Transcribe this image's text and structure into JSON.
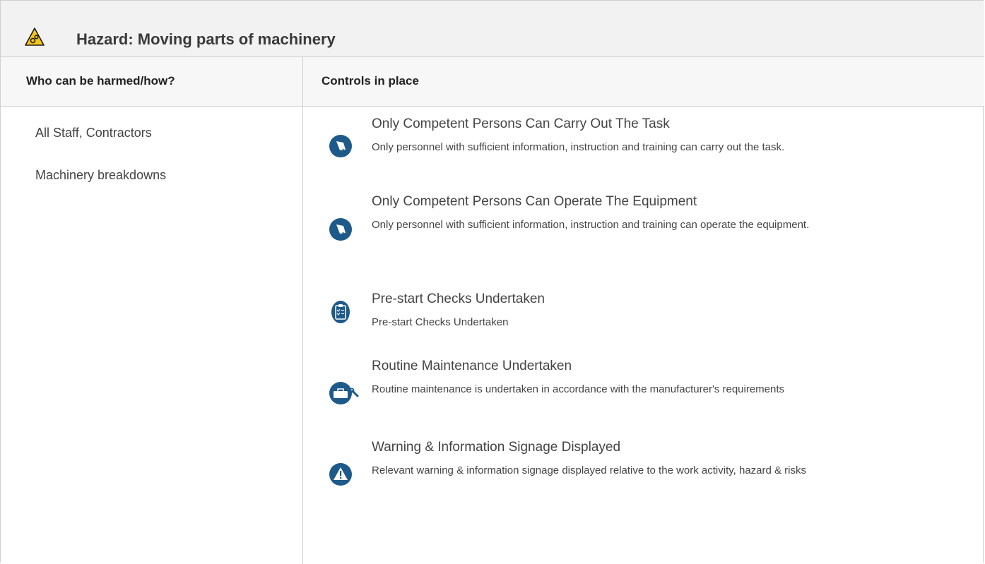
{
  "hazard": {
    "title": "Hazard:  Moving parts of machinery",
    "icon": "machinery-warning-icon",
    "colors": {
      "warning_yellow": "#f5c518",
      "icon_blue": "#1d5a8a"
    }
  },
  "columns": {
    "harmed_header": "Who can be harmed/how?",
    "controls_header": "Controls in place"
  },
  "harmed": [
    "All Staff, Contractors",
    "Machinery breakdowns"
  ],
  "controls": [
    {
      "icon": "competent-person-icon",
      "title": "Only Competent Persons Can Carry Out The Task",
      "description": "Only personnel with sufficient information, instruction and training can carry out the task."
    },
    {
      "icon": "competent-person-icon",
      "title": "Only Competent Persons Can Operate The Equipment",
      "description": "Only personnel with sufficient information, instruction and training can operate the equipment."
    },
    {
      "icon": "checklist-icon",
      "title": "Pre-start Checks Undertaken",
      "description": "Pre-start Checks Undertaken"
    },
    {
      "icon": "maintenance-toolbox-icon",
      "title": "Routine Maintenance Undertaken",
      "description": "Routine maintenance is undertaken in accordance with the manufacturer's requirements"
    },
    {
      "icon": "warning-sign-icon",
      "title": "Warning & Information Signage Displayed",
      "description": "Relevant warning & information signage displayed relative to the work activity, hazard & risks"
    }
  ]
}
